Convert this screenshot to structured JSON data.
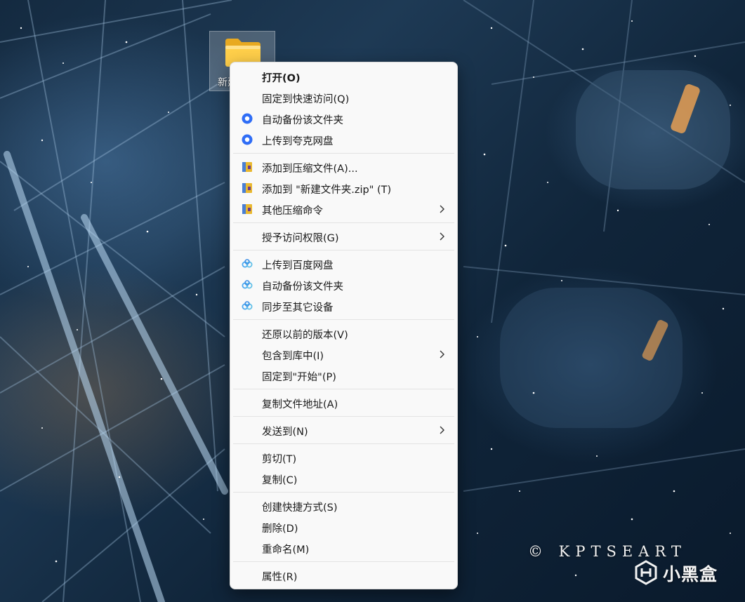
{
  "desktop": {
    "folder_label": "新建文件夹",
    "watermark": "© KPTSEART",
    "brand_name": "小黑盒"
  },
  "context_menu": {
    "items": [
      {
        "label": "打开(O)",
        "icon": "none",
        "bold": true
      },
      {
        "label": "固定到快速访问(Q)",
        "icon": "none"
      },
      {
        "label": "自动备份该文件夹",
        "icon": "quark-cloud-icon"
      },
      {
        "label": "上传到夸克网盘",
        "icon": "quark-cloud-icon"
      },
      {
        "label": "添加到压缩文件(A)...",
        "icon": "winrar-archive-icon"
      },
      {
        "label": "添加到 \"新建文件夹.zip\" (T)",
        "icon": "winrar-archive-icon"
      },
      {
        "label": "其他压缩命令",
        "icon": "winrar-archive-icon",
        "submenu": true
      },
      {
        "label": "授予访问权限(G)",
        "icon": "none",
        "submenu": true
      },
      {
        "label": "上传到百度网盘",
        "icon": "baidu-cloud-icon"
      },
      {
        "label": "自动备份该文件夹",
        "icon": "baidu-cloud-icon"
      },
      {
        "label": "同步至其它设备",
        "icon": "baidu-cloud-icon"
      },
      {
        "label": "还原以前的版本(V)",
        "icon": "none"
      },
      {
        "label": "包含到库中(I)",
        "icon": "none",
        "submenu": true
      },
      {
        "label": "固定到\"开始\"(P)",
        "icon": "none"
      },
      {
        "label": "复制文件地址(A)",
        "icon": "none"
      },
      {
        "label": "发送到(N)",
        "icon": "none",
        "submenu": true
      },
      {
        "label": "剪切(T)",
        "icon": "none"
      },
      {
        "label": "复制(C)",
        "icon": "none"
      },
      {
        "label": "创建快捷方式(S)",
        "icon": "none"
      },
      {
        "label": "删除(D)",
        "icon": "none"
      },
      {
        "label": "重命名(M)",
        "icon": "none"
      },
      {
        "label": "属性(R)",
        "icon": "none"
      }
    ]
  },
  "colors": {
    "menu_background": "#f9f9f9",
    "quark_blue": "#2f6df6",
    "baidu_blue": "#4aa8f0",
    "winrar_yellow": "#e9b82f"
  }
}
